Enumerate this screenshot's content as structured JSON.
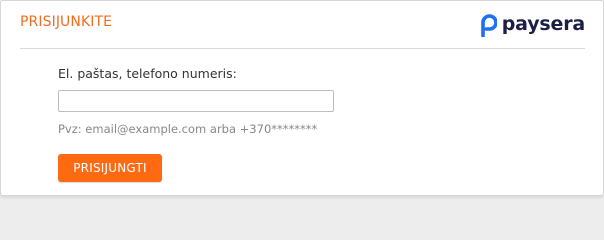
{
  "header": {
    "title": "PRISIJUNKITE",
    "logo_text": "paysera",
    "logo_icon": "paysera-p-logo-icon"
  },
  "form": {
    "label": "El. paštas, telefono numeris:",
    "input_value": "",
    "input_placeholder": "",
    "hint": "Pvz: email@example.com arba +370********",
    "submit_label": "PRISIJUNGTI"
  },
  "colors": {
    "accent": "#f26c1f",
    "button": "#fe6a12",
    "logo_blue": "#1f6ff2",
    "logo_text": "#1b1f45"
  }
}
